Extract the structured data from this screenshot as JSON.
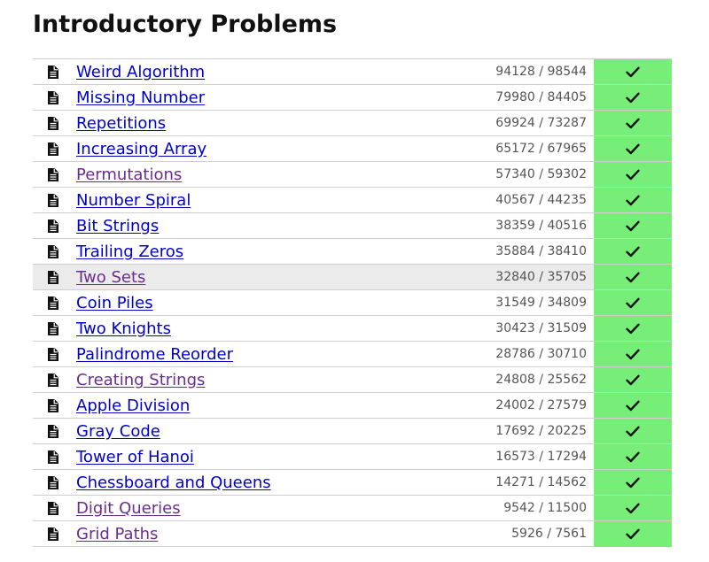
{
  "page": {
    "title": "Introductory Problems"
  },
  "colors": {
    "link": "#0000cc",
    "visited_link": "#6b2c91",
    "solved_status": "#77ee77",
    "highlight_row": "#ebebeb",
    "count_text": "#555555"
  },
  "icons": {
    "row_icon": "document-icon",
    "status_icon": "checkmark-icon"
  },
  "tasks": [
    {
      "name": "Weird Algorithm",
      "count": "94128 / 98544",
      "status": "solved",
      "visited": false,
      "highlighted": false
    },
    {
      "name": "Missing Number",
      "count": "79980 / 84405",
      "status": "solved",
      "visited": false,
      "highlighted": false
    },
    {
      "name": "Repetitions",
      "count": "69924 / 73287",
      "status": "solved",
      "visited": false,
      "highlighted": false
    },
    {
      "name": "Increasing Array",
      "count": "65172 / 67965",
      "status": "solved",
      "visited": false,
      "highlighted": false
    },
    {
      "name": "Permutations",
      "count": "57340 / 59302",
      "status": "solved",
      "visited": true,
      "highlighted": false
    },
    {
      "name": "Number Spiral",
      "count": "40567 / 44235",
      "status": "solved",
      "visited": false,
      "highlighted": false
    },
    {
      "name": "Bit Strings",
      "count": "38359 / 40516",
      "status": "solved",
      "visited": false,
      "highlighted": false
    },
    {
      "name": "Trailing Zeros",
      "count": "35884 / 38410",
      "status": "solved",
      "visited": false,
      "highlighted": false
    },
    {
      "name": "Two Sets",
      "count": "32840 / 35705",
      "status": "solved",
      "visited": true,
      "highlighted": true
    },
    {
      "name": "Coin Piles",
      "count": "31549 / 34809",
      "status": "solved",
      "visited": false,
      "highlighted": false
    },
    {
      "name": "Two Knights",
      "count": "30423 / 31509",
      "status": "solved",
      "visited": false,
      "highlighted": false
    },
    {
      "name": "Palindrome Reorder",
      "count": "28786 / 30710",
      "status": "solved",
      "visited": false,
      "highlighted": false
    },
    {
      "name": "Creating Strings",
      "count": "24808 / 25562",
      "status": "solved",
      "visited": true,
      "highlighted": false
    },
    {
      "name": "Apple Division",
      "count": "24002 / 27579",
      "status": "solved",
      "visited": false,
      "highlighted": false
    },
    {
      "name": "Gray Code",
      "count": "17692 / 20225",
      "status": "solved",
      "visited": false,
      "highlighted": false
    },
    {
      "name": "Tower of Hanoi",
      "count": "16573 / 17294",
      "status": "solved",
      "visited": false,
      "highlighted": false
    },
    {
      "name": "Chessboard and Queens",
      "count": "14271 / 14562",
      "status": "solved",
      "visited": false,
      "highlighted": false
    },
    {
      "name": "Digit Queries",
      "count": "9542 / 11500",
      "status": "solved",
      "visited": true,
      "highlighted": false
    },
    {
      "name": "Grid Paths",
      "count": "5926 / 7561",
      "status": "solved",
      "visited": true,
      "highlighted": false
    }
  ]
}
